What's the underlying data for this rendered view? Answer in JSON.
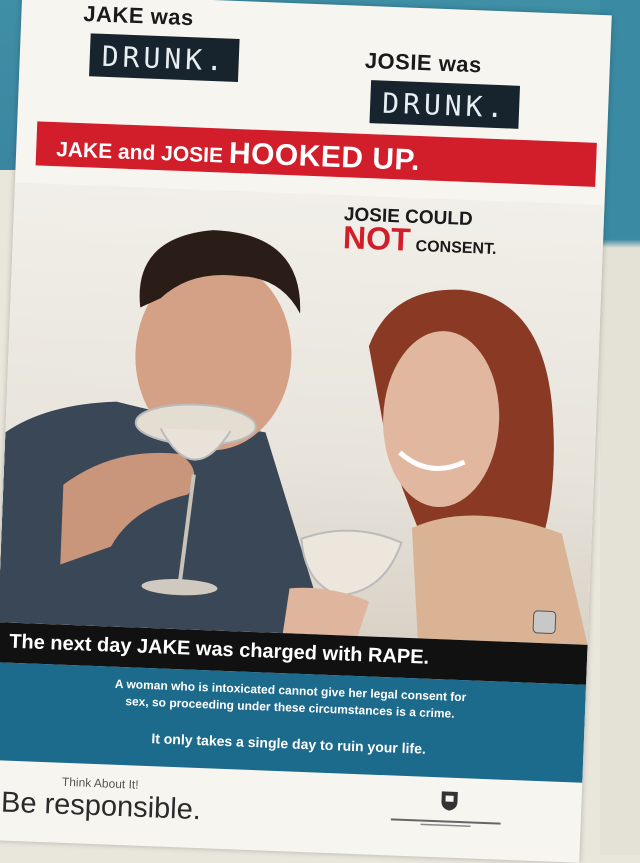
{
  "poster": {
    "headline_jake": "JAKE was",
    "drunk_jake": "DRUNK.",
    "headline_josie": "JOSIE was",
    "drunk_josie": "DRUNK.",
    "hooked_prefix": "JAKE and JOSIE",
    "hooked_big": "HOOKED UP.",
    "consent_line1": "JOSIE COULD",
    "consent_not": "NOT",
    "consent_word": "CONSENT.",
    "charged": "The next day JAKE was charged with RAPE.",
    "info_line1": "A woman who is intoxicated cannot give her legal consent for",
    "info_line2": "sex, so proceeding under these circumstances is a crime.",
    "info_line3": "It only takes a single day to ruin your life.",
    "think": "Think About It!",
    "responsible": "Be responsible."
  },
  "colors": {
    "wall_blue": "#3f8fa6",
    "banner_red": "#d21e2a",
    "drunk_box": "#17232d",
    "info_blue": "#1c6a8c"
  }
}
